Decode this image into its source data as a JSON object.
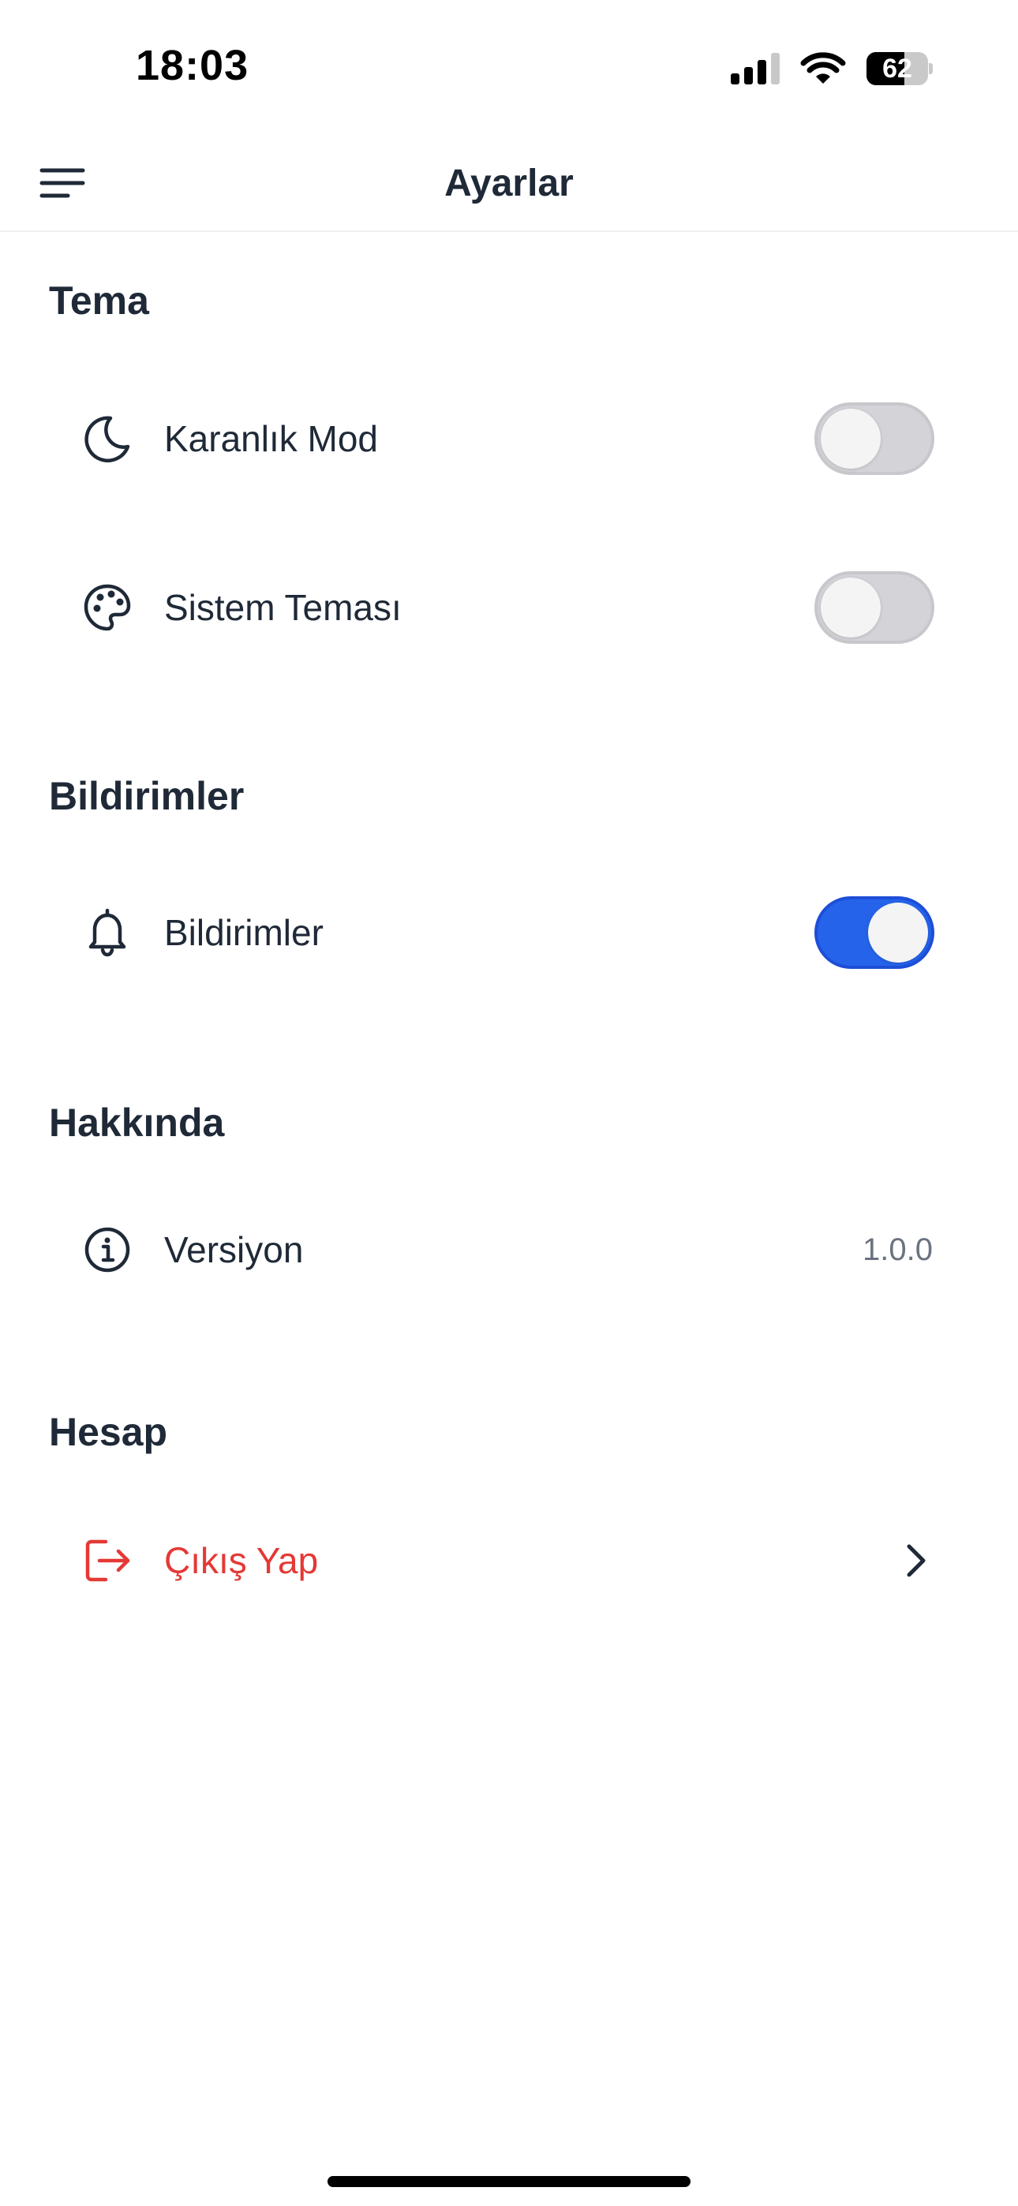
{
  "status_bar": {
    "time": "18:03",
    "battery_level": "62",
    "battery_fraction": 0.62,
    "icons": [
      "signal-icon",
      "wifi-icon",
      "battery-icon"
    ]
  },
  "header": {
    "title": "Ayarlar",
    "menu_icon": "menu-icon"
  },
  "sections": {
    "theme": {
      "title": "Tema",
      "items": [
        {
          "label": "Karanlık Mod",
          "icon": "moon-icon",
          "toggle_on": false
        },
        {
          "label": "Sistem Teması",
          "icon": "palette-icon",
          "toggle_on": false
        }
      ]
    },
    "notifications": {
      "title": "Bildirimler",
      "items": [
        {
          "label": "Bildirimler",
          "icon": "bell-icon",
          "toggle_on": true
        }
      ]
    },
    "about": {
      "title": "Hakkında",
      "items": [
        {
          "label": "Versiyon",
          "icon": "info-icon",
          "value": "1.0.0"
        }
      ]
    },
    "account": {
      "title": "Hesap",
      "items": [
        {
          "label": "Çıkış Yap",
          "icon": "logout-icon",
          "trailing_icon": "chevron-right-icon"
        }
      ]
    }
  },
  "colors": {
    "accent": "#2563eb",
    "danger": "#e53935",
    "text": "#1f2937",
    "muted": "#6b7280",
    "toggle_off": "#d4d4d8"
  }
}
